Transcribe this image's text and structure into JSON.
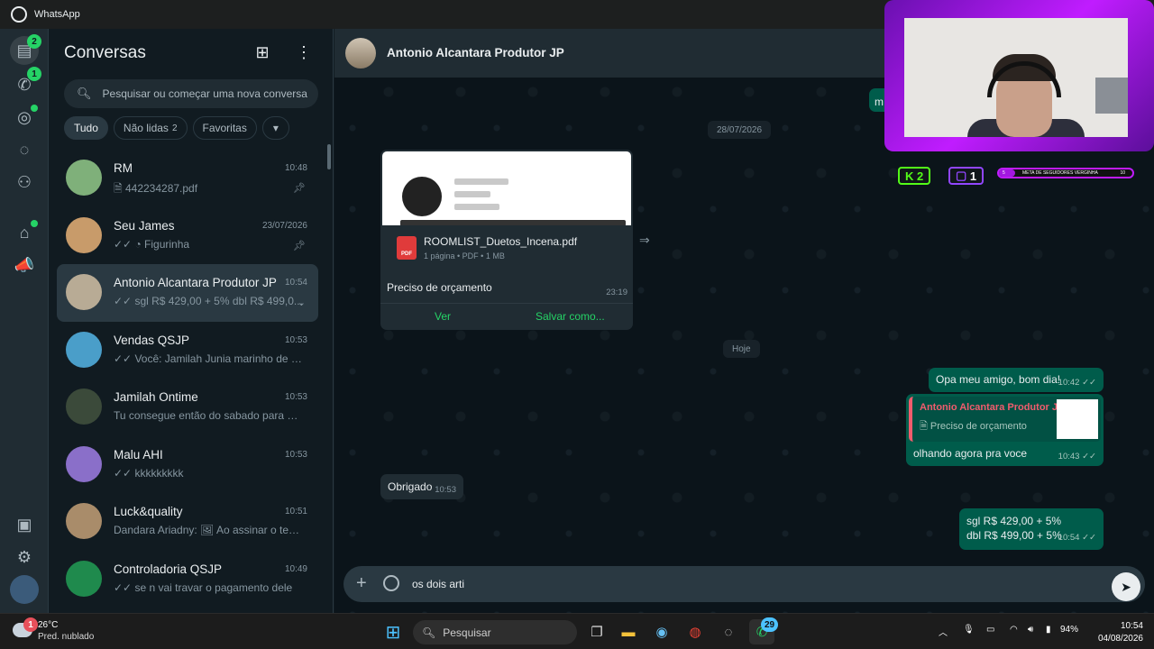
{
  "window": {
    "title": "WhatsApp"
  },
  "rail": {
    "chats_badge": "2",
    "calls_badge": "1",
    "items": [
      "chats-icon",
      "calls-icon",
      "status-icon",
      "channels-icon",
      "communities-icon",
      "business-tools-icon",
      "advertise-icon",
      "media-icon",
      "settings-icon",
      "profile-avatar"
    ]
  },
  "sidebar": {
    "title": "Conversas",
    "search_placeholder": "Pesquisar ou começar uma nova conversa",
    "filters": [
      {
        "label": "Tudo",
        "count": ""
      },
      {
        "label": "Não lidas",
        "count": "2"
      },
      {
        "label": "Favoritas",
        "count": ""
      }
    ],
    "chats": [
      {
        "name": "RM",
        "time": "10:48",
        "preview": "🗎 442234287.pdf",
        "pinned": true,
        "avatar_color": "#7fb07a"
      },
      {
        "name": "Seu James",
        "time": "23/07/2026",
        "preview": "✓✓ ◔ Figurinha",
        "pinned": true,
        "avatar_color": "#c89b6a"
      },
      {
        "name": "Antonio Alcantara Produtor JP",
        "time": "10:54",
        "preview": "✓✓ sgl R$ 429,00 + 5% dbl R$ 499,0...",
        "pinned": false,
        "avatar_color": "#b8ab95"
      },
      {
        "name": "Vendas QSJP",
        "time": "10:53",
        "preview": "✓✓ Você: Jamilah Junia marinho de bri...",
        "pinned": false,
        "avatar_color": "#4a9ec9"
      },
      {
        "name": "Jamilah Ontime",
        "time": "10:53",
        "preview": "Tu consegue então do sabado para do...",
        "pinned": false,
        "avatar_color": "#3b4a3a"
      },
      {
        "name": "Malu AHI",
        "time": "10:53",
        "preview": "✓✓ kkkkkkkkk",
        "pinned": false,
        "avatar_color": "#8a6fc9"
      },
      {
        "name": "Luck&quality",
        "time": "10:51",
        "preview": "Dandara Ariadny: 🖼 Ao assinar o term...",
        "pinned": false,
        "avatar_color": "#a98c6a"
      },
      {
        "name": "Controladoria QSJP",
        "time": "10:49",
        "preview": "✓✓ se n vai travar o pagamento dele",
        "pinned": false,
        "avatar_color": "#1f8a4d"
      }
    ]
  },
  "chat": {
    "contact": "Antonio Alcantara Produtor JP",
    "date_pill_1": "28/07/2026",
    "date_pill_2": "Hoje",
    "doc": {
      "filename": "ROOMLIST_Duetos_Incena.pdf",
      "meta": "1 página • PDF • 1 MB",
      "pdf_label": "PDF",
      "caption": "Preciso de orçamento",
      "time": "23:19",
      "action_view": "Ver",
      "action_save": "Salvar como..."
    },
    "messages": {
      "out1": {
        "text": "Opa meu amigo, bom dia!",
        "time": "10:42 ✓✓"
      },
      "quote_name": "Antonio Alcantara Produtor JP",
      "quote_text": "🗎 Preciso de orçamento",
      "out2": {
        "text": "olhando agora pra voce",
        "time": "10:43 ✓✓"
      },
      "in1": {
        "text": "Obrigado",
        "time": "10:53"
      },
      "out3_line1": "sgl R$ 429,00 + 5%",
      "out3_line2": "dbl R$ 499,00 + 5%",
      "out3_time": "10:54 ✓✓",
      "partial": "m"
    },
    "composer_text": "os dois arti"
  },
  "overlay": {
    "kick_count": "2",
    "twitch_count": "1",
    "goal_text": "META DE SEGUIDORES VERGINHA",
    "goal_value": "10",
    "goal_progress_left": "5",
    "goal_fraction": 0.12
  },
  "taskbar": {
    "weather_badge": "1",
    "temp": "26°C",
    "condition": "Pred. nublado",
    "search": "Pesquisar",
    "whatsapp_badge": "29",
    "battery": "94%",
    "time": "10:54",
    "date": "04/08/2026"
  }
}
